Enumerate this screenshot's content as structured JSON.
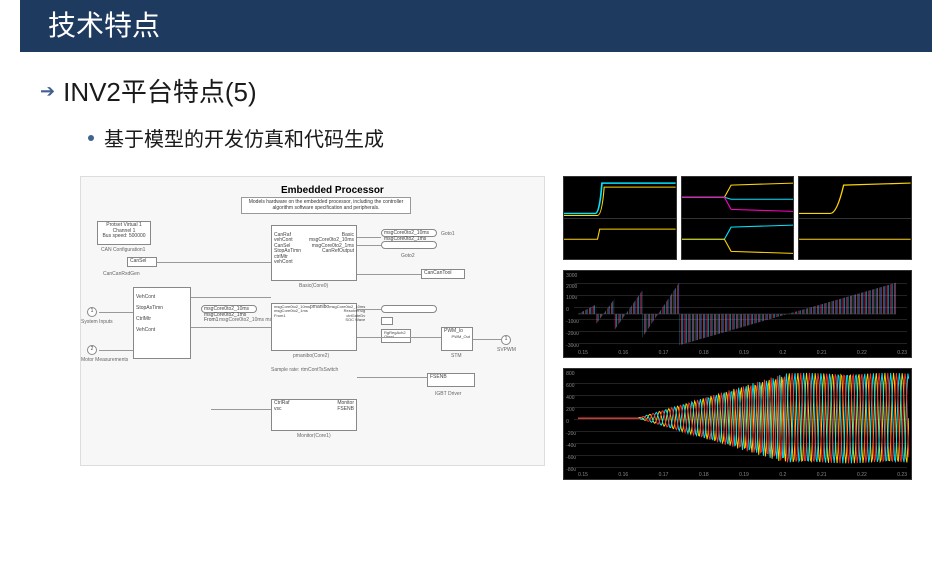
{
  "title": "技术特点",
  "heading": "INV2平台特点(5)",
  "sub_point": "基于模型的开发仿真和代码生成",
  "simulink": {
    "processor_title": "Embedded Processor",
    "processor_desc": "Models hardware on the embedded processor, including the controller algorithm software specification and peripherals.",
    "inputs": {
      "system_inputs": "System Inputs",
      "motor_measurements": "Motor Measurements",
      "vehcont": "VehCont",
      "stopastimn": "StopAsTimn",
      "ctrlmtr": "CtrlMtr",
      "vehcont2": "VehCont"
    },
    "can_block": "Protset Virtual 1\nChannel 1\nBus speed: 500000",
    "can_config": "CAN Configuration1",
    "can_sel": "CanSel",
    "can_rx_gen": "CanCanRxdGen",
    "core0_block": {
      "inputs": "CanRaf\nvehCont\nCanSel\nStopAsTimn\nctrlMtr\nvehCont",
      "outputs": "Basic\nmsgCore0to2_10ms\nmsgCore0to2_1ms\nCanRefOutput",
      "label": "Basic(Core0)"
    },
    "core2_block": {
      "inputs": "msgCore0to2_10ms\nmsgCore0to2_1ms\nFrom1",
      "center": "pmanibo",
      "outputs": "msgCore0to2_10ms\nResolverSig\nctrlGateDv\nSOC Wave",
      "label": "pmanibo(Core2)"
    },
    "monitor_block": {
      "inputs": "CtrlRaf\nvsc",
      "outputs": "Monitor\nFSENB",
      "label": "Monitor(Core1)"
    },
    "pwm_block": {
      "label": "PWM_lo",
      "out": "PWM_Out",
      "sub": "STM"
    },
    "igbt_driver": "IGBT Driver",
    "svpwm": "SVPWM",
    "goto1": "Goto1",
    "goto2": "Goto2",
    "terminator": "msgCore0to2_10ms\nmsgCore0to2_1ms",
    "sample_caption": "Sample rate: rtmContTsSwitch",
    "rgn_block": "RgRegAch2\nOtwsl",
    "can_can_tool": "CanCanTool"
  },
  "oscilloscope": {
    "mid_y_ticks": [
      "3000",
      "2000",
      "1000",
      "0",
      "-1000",
      "-2000",
      "-3000"
    ],
    "x_ticks": [
      "0.15",
      "0.16",
      "0.17",
      "0.18",
      "0.19",
      "0.2",
      "0.21",
      "0.22",
      "0.23"
    ],
    "bot_y_ticks": [
      "800",
      "600",
      "400",
      "200",
      "0",
      "-200",
      "-400",
      "-600",
      "-800"
    ],
    "colors": {
      "yellow": "#ffd400",
      "cyan": "#00e5ff",
      "magenta": "#ff00c8",
      "blue": "#0080ff",
      "green": "#00d000",
      "red": "#ff3030"
    }
  }
}
